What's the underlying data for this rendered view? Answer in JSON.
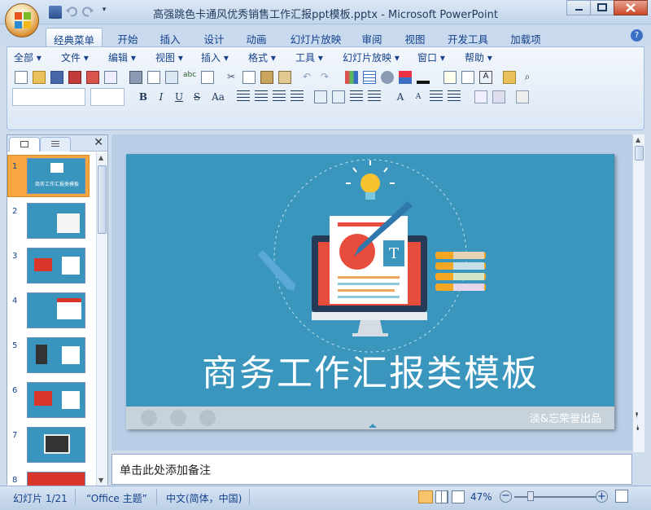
{
  "window": {
    "title": "高强跳色卡通风优秀销售工作汇报ppt模板.pptx - Microsoft PowerPoint"
  },
  "tabs": [
    {
      "label": "经典菜单"
    },
    {
      "label": "开始"
    },
    {
      "label": "插入"
    },
    {
      "label": "设计"
    },
    {
      "label": "动画"
    },
    {
      "label": "幻灯片放映"
    },
    {
      "label": "审阅"
    },
    {
      "label": "视图"
    },
    {
      "label": "开发工具"
    },
    {
      "label": "加载项"
    }
  ],
  "menus": [
    {
      "label": "全部"
    },
    {
      "label": "文件"
    },
    {
      "label": "编辑"
    },
    {
      "label": "视图"
    },
    {
      "label": "插入"
    },
    {
      "label": "格式"
    },
    {
      "label": "工具"
    },
    {
      "label": "幻灯片放映"
    },
    {
      "label": "窗口"
    },
    {
      "label": "帮助"
    }
  ],
  "slides": [
    {
      "num": "1",
      "title": "商务工作汇报类模板"
    },
    {
      "num": "2"
    },
    {
      "num": "3"
    },
    {
      "num": "4"
    },
    {
      "num": "5"
    },
    {
      "num": "6"
    },
    {
      "num": "7"
    },
    {
      "num": "8"
    }
  ],
  "slide": {
    "title": "商务工作汇报类模板",
    "watermark": "淡&忘荣誉出品",
    "icon_letter": "T"
  },
  "notes": {
    "placeholder": "单击此处添加备注"
  },
  "status": {
    "slide_pos": "幻灯片 1/21",
    "theme": "“Office 主题”",
    "language": "中文(简体，中国)",
    "zoom": "47%"
  },
  "colors": {
    "accent": "#3a96bd",
    "ribbon": "#dce7f5",
    "active_thumb": "#f7a640"
  },
  "icons": [
    "office-logo-icon",
    "save-icon",
    "undo-icon",
    "redo-icon",
    "close-icon",
    "minimize-icon",
    "maximize-icon",
    "help-icon",
    "bold-icon",
    "italic-icon",
    "underline-icon"
  ]
}
